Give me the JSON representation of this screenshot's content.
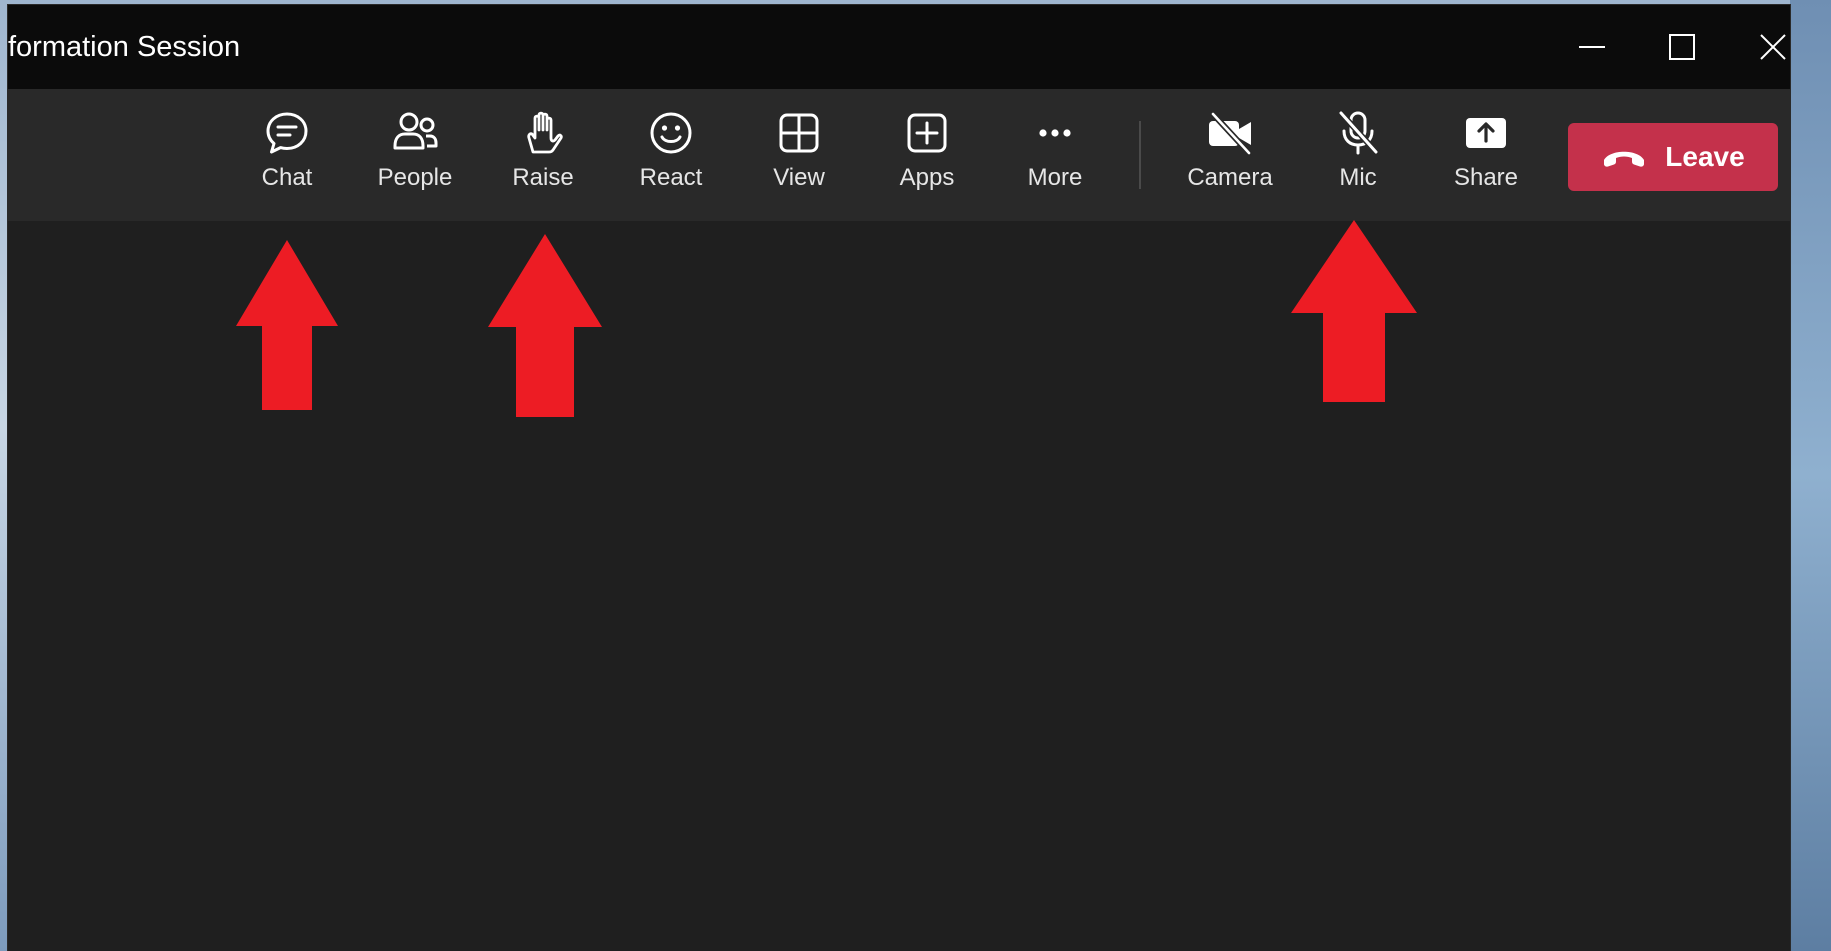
{
  "window": {
    "title": "formation Session"
  },
  "window_controls": [
    {
      "name": "minimize-button",
      "icon": "minimize-icon"
    },
    {
      "name": "maximize-button",
      "icon": "maximize-icon"
    },
    {
      "name": "close-button",
      "icon": "close-icon"
    }
  ],
  "toolbar": {
    "chat": {
      "label": "Chat",
      "icon": "chat-icon"
    },
    "people": {
      "label": "People",
      "icon": "people-icon"
    },
    "raise": {
      "label": "Raise",
      "icon": "hand-icon"
    },
    "react": {
      "label": "React",
      "icon": "smiley-icon"
    },
    "view": {
      "label": "View",
      "icon": "grid-icon"
    },
    "apps": {
      "label": "Apps",
      "icon": "plus-box-icon"
    },
    "more": {
      "label": "More",
      "icon": "more-icon"
    },
    "camera": {
      "label": "Camera",
      "icon": "camera-off-icon"
    },
    "mic": {
      "label": "Mic",
      "icon": "mic-off-icon"
    },
    "share": {
      "label": "Share",
      "icon": "share-icon"
    },
    "leave": {
      "label": "Leave",
      "icon": "hangup-icon"
    }
  },
  "colors": {
    "titlebar": "#0b0b0b",
    "toolbar": "#292929",
    "stage": "#1f1f1f",
    "leave_button": "#c4314b",
    "annotation_arrow": "#ed1c24"
  },
  "annotations": [
    {
      "name": "arrow-to-chat",
      "color": "#ed1c24"
    },
    {
      "name": "arrow-to-raise",
      "color": "#ed1c24"
    },
    {
      "name": "arrow-to-mic",
      "color": "#ed1c24"
    }
  ]
}
